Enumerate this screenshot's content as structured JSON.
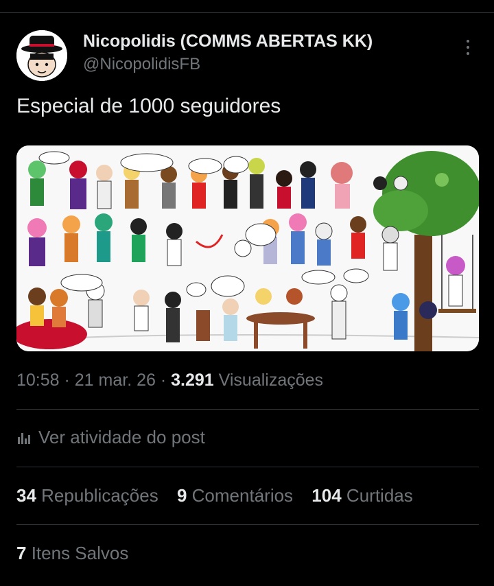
{
  "author": {
    "name": "Nicopolidis (COMMS ABERTAS KK)",
    "handle": "@NicopolidisFB",
    "avatar_icon": "avatar-icon"
  },
  "post": {
    "text": "Especial de 1000 seguidores",
    "media_icon": "image-icon"
  },
  "meta": {
    "time": "10:58",
    "dot1": " · ",
    "date": "21 mar. 26",
    "dot2": " · ",
    "views_count": "3.291",
    "views_label": " Visualizações"
  },
  "activity": {
    "label": "Ver atividade do post",
    "icon": "analytics-icon"
  },
  "stats": {
    "reposts_count": "34",
    "reposts_label": "Republicações",
    "comments_count": "9",
    "comments_label": "Comentários",
    "likes_count": "104",
    "likes_label": "Curtidas",
    "saved_count": "7",
    "saved_label": "Itens Salvos"
  },
  "colors": {
    "background": "#000000",
    "text_primary": "#e7e9ea",
    "text_secondary": "#71767b",
    "divider": "#2f3336"
  }
}
